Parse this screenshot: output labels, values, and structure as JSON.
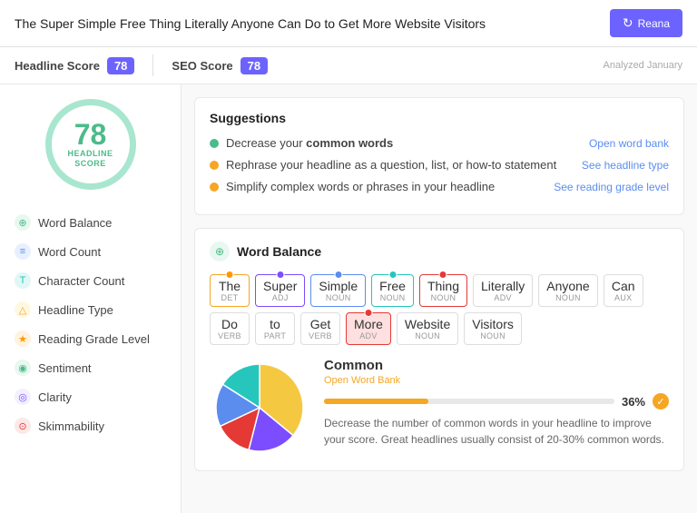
{
  "header": {
    "title": "The Super Simple Free Thing Literally Anyone Can Do to Get More Website Visitors",
    "reanalyze_label": "Reana",
    "analyzed_label": "Analyzed January"
  },
  "scores": {
    "headline_label": "Headline Score",
    "headline_value": "78",
    "seo_label": "SEO Score",
    "seo_value": "78"
  },
  "score_circle": {
    "number": "78",
    "label": "HEADLINE\nSCORE"
  },
  "nav": {
    "items": [
      {
        "id": "word-balance",
        "label": "Word Balance",
        "icon": "⊕",
        "icon_class": "nav-icon-green"
      },
      {
        "id": "word-count",
        "label": "Word Count",
        "icon": "≡",
        "icon_class": "nav-icon-blue"
      },
      {
        "id": "character-count",
        "label": "Character Count",
        "icon": "T",
        "icon_class": "nav-icon-teal"
      },
      {
        "id": "headline-type",
        "label": "Headline Type",
        "icon": "△",
        "icon_class": "nav-icon-yellow"
      },
      {
        "id": "reading-grade",
        "label": "Reading Grade Level",
        "icon": "★",
        "icon_class": "nav-icon-orange"
      },
      {
        "id": "sentiment",
        "label": "Sentiment",
        "icon": "◉",
        "icon_class": "nav-icon-green"
      },
      {
        "id": "clarity",
        "label": "Clarity",
        "icon": "◎",
        "icon_class": "nav-icon-purple"
      },
      {
        "id": "skimmability",
        "label": "Skimmability",
        "icon": "⊙",
        "icon_class": "nav-icon-red"
      }
    ]
  },
  "suggestions": {
    "title": "Suggestions",
    "items": [
      {
        "dot": "green",
        "text_plain": "Decrease your ",
        "text_bold": "common words",
        "link": "Open word bank",
        "link_id": "open-word-bank"
      },
      {
        "dot": "yellow",
        "text_plain": "Rephrase your headline as a question, list, or how-to statement",
        "text_bold": "",
        "link": "See headline type",
        "link_id": "see-headline-type"
      },
      {
        "dot": "yellow",
        "text_plain": "Simplify complex words or phrases in your headline",
        "text_bold": "",
        "link": "See reading grade level",
        "link_id": "see-reading-grade"
      }
    ]
  },
  "word_balance": {
    "title": "Word Balance",
    "words": [
      {
        "text": "The",
        "pos": "DET",
        "dot_color": "dot-orange",
        "chip_class": "chip-the"
      },
      {
        "text": "Super",
        "pos": "ADJ",
        "dot_color": "dot-purple",
        "chip_class": "chip-super"
      },
      {
        "text": "Simple",
        "pos": "NOUN",
        "dot_color": "dot-blue",
        "chip_class": "chip-simple"
      },
      {
        "text": "Free",
        "pos": "NOUN",
        "dot_color": "dot-teal",
        "chip_class": "chip-free"
      },
      {
        "text": "Thing",
        "pos": "NOUN",
        "dot_color": "dot-red",
        "chip_class": "chip-thing"
      },
      {
        "text": "Literally",
        "pos": "ADV",
        "dot_color": "",
        "chip_class": ""
      },
      {
        "text": "Anyone",
        "pos": "NOUN",
        "dot_color": "",
        "chip_class": ""
      },
      {
        "text": "Can",
        "pos": "AUX",
        "dot_color": "",
        "chip_class": ""
      },
      {
        "text": "Do",
        "pos": "VERB",
        "dot_color": "",
        "chip_class": ""
      },
      {
        "text": "to",
        "pos": "PART",
        "dot_color": "",
        "chip_class": ""
      },
      {
        "text": "Get",
        "pos": "VERB",
        "dot_color": "",
        "chip_class": ""
      },
      {
        "text": "More",
        "pos": "ADV",
        "dot_color": "dot-red",
        "chip_class": "chip-more"
      },
      {
        "text": "Website",
        "pos": "NOUN",
        "dot_color": "",
        "chip_class": ""
      },
      {
        "text": "Visitors",
        "pos": "NOUN",
        "dot_color": "",
        "chip_class": ""
      }
    ]
  },
  "common_section": {
    "label": "Common",
    "open_bank": "Open Word Bank",
    "percentage": "36%",
    "fill_width": "36",
    "description": "Decrease the number of common words in your headline to improve your score. Great headlines usually consist of 20-30% common words."
  },
  "pie": {
    "segments": [
      {
        "color": "#f5c842",
        "pct": 36
      },
      {
        "color": "#7c4dff",
        "pct": 18
      },
      {
        "color": "#e53935",
        "pct": 14
      },
      {
        "color": "#5b8dee",
        "pct": 16
      },
      {
        "color": "#26c6bc",
        "pct": 16
      }
    ]
  }
}
